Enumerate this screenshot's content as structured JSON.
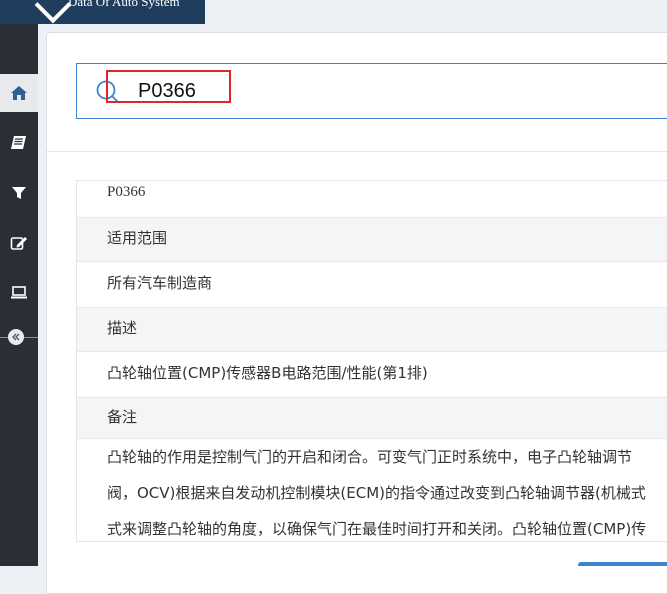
{
  "app": {
    "logo_text": "Data Of Auto System"
  },
  "sidebar": {
    "items": [
      {
        "icon": "home-icon",
        "active": true
      },
      {
        "icon": "book-icon",
        "active": false
      },
      {
        "icon": "filter-icon",
        "active": false
      },
      {
        "icon": "edit-icon",
        "active": false
      },
      {
        "icon": "laptop-icon",
        "active": false
      }
    ],
    "collapse_icon": "double-chevron-left-icon"
  },
  "search": {
    "value": "P0366",
    "icon": "search-icon"
  },
  "result": {
    "code": "P0366",
    "applicable_label": "适用范围",
    "applicable_value": "所有汽车制造商",
    "description_label": "描述",
    "description_value": "凸轮轴位置(CMP)传感器B电路范围/性能(第1排)",
    "notes_label": "备注",
    "notes_lines": [
      "凸轮轴的作用是控制气门的开启和闭合。可变气门正时系统中，电子凸轮轴调节",
      "阀，OCV)根据来自发动机控制模块(ECM)的指令通过改变到凸轮轴调节器(机械式",
      "式来调整凸轮轴的角度，以确保气门在最佳时间打开和关闭。凸轮轴位置(CMP)传"
    ]
  },
  "colors": {
    "accent": "#3c83d0",
    "highlight": "#e0252b",
    "sidebar_bg": "#2b2f35",
    "logo_bg": "#1f3d5c"
  }
}
